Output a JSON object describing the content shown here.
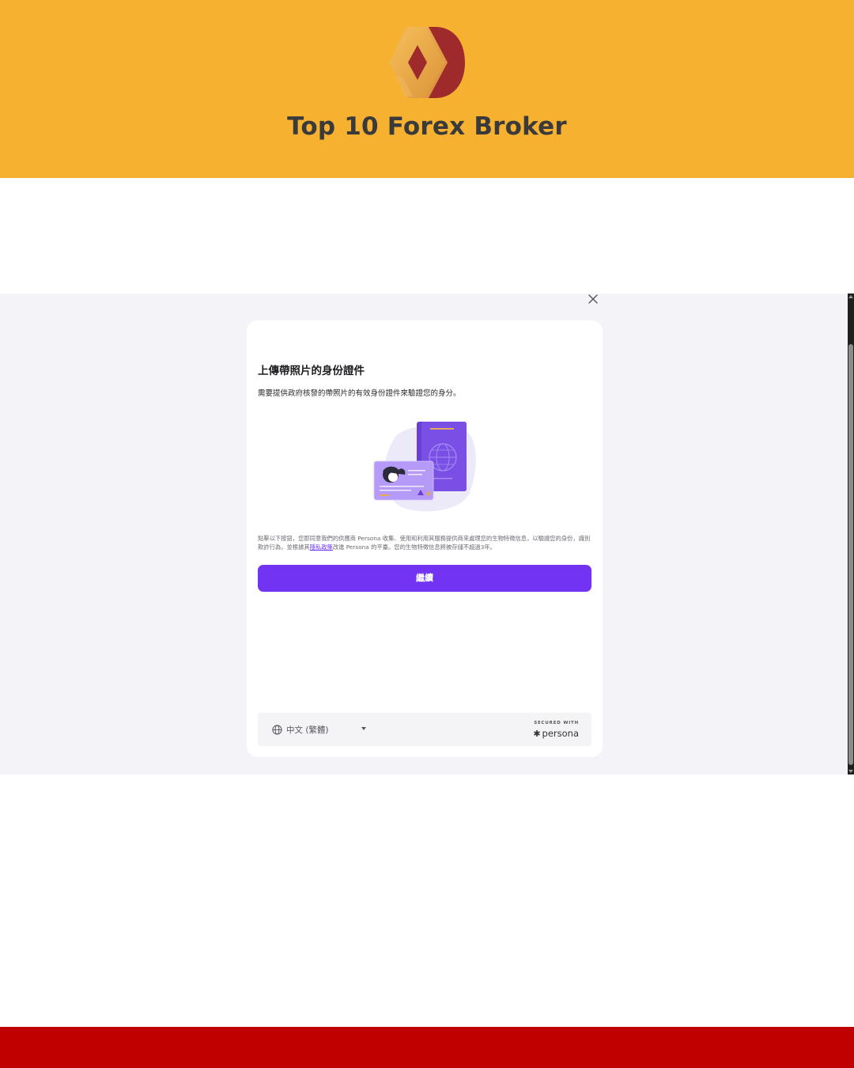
{
  "brand": {
    "title": "Top 10 Forex Broker",
    "colors": {
      "header_bg": "#f6b130",
      "bottom_bar": "#c00000",
      "logo_red": "#9e2a2b",
      "logo_gold": "#e9a63b"
    }
  },
  "modal": {
    "close_icon": "close-icon",
    "title": "上傳帶照片的身份證件",
    "subtitle": "需要提供政府核發的帶照片的有效身份證件來驗證您的身分。",
    "illustration_icon": "id-card-and-passport-illustration",
    "consent": {
      "before_link": "點擊以下按鈕，您即同意我們的供應商 Persona 收集、使用和利用其服務提供商來處理您的生物特徵信息，以驗證您的身份，識別欺詐行為，並根據其",
      "link": "隱私政策",
      "after_link": "改進 Persona 的平臺。您的生物特徵信息將被存儲不超過3年。"
    },
    "continue_label": "繼續",
    "accent_color": "#7333f2",
    "footer": {
      "language": "中文 (繁體)",
      "globe_icon": "globe-icon",
      "dropdown_icon": "caret-down-icon",
      "secured_with": "SECURED WITH",
      "persona_brand": "persona"
    }
  }
}
